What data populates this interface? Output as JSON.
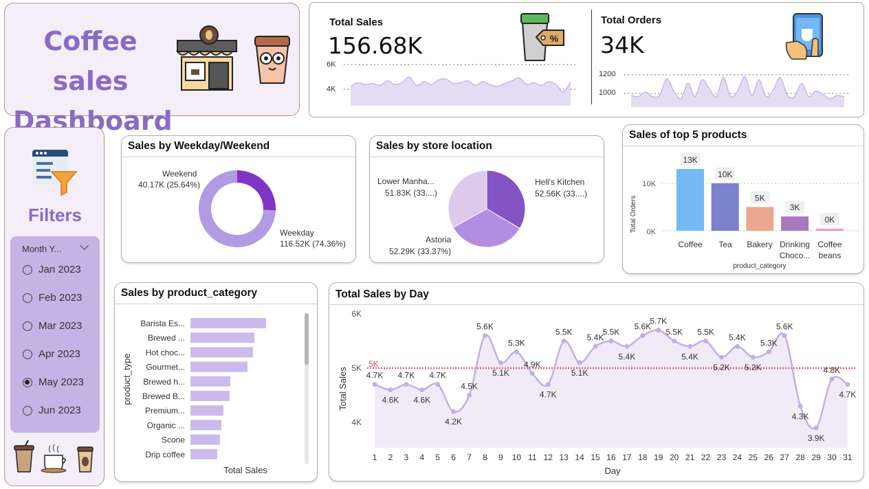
{
  "dashboard": {
    "title_line1": "Coffee sales",
    "title_line2": "Dashboard"
  },
  "kpis": {
    "total_sales": {
      "title": "Total Sales",
      "value": "156.68K",
      "axis_hi": "6K",
      "axis_lo": "4K"
    },
    "total_orders": {
      "title": "Total Orders",
      "value": "34K",
      "axis_hi": "1200",
      "axis_lo": "1000"
    }
  },
  "filters": {
    "title": "Filters",
    "slicer_header": "Month Y...",
    "options": [
      {
        "label": "Jan 2023",
        "selected": false
      },
      {
        "label": "Feb 2023",
        "selected": false
      },
      {
        "label": "Mar 2023",
        "selected": false
      },
      {
        "label": "Apr 2023",
        "selected": false
      },
      {
        "label": "May 2023",
        "selected": true
      },
      {
        "label": "Jun 2023",
        "selected": false
      }
    ]
  },
  "weekday_weekend": {
    "title": "Sales by Weekday/Weekend",
    "weekend_name": "Weekend",
    "weekend_value": "40.17K (25.64%)",
    "weekday_name": "Weekday",
    "weekday_value": "116.52K (74.36%)"
  },
  "store_location": {
    "title": "Sales by store location",
    "lower_name": "Lower Manha...",
    "lower_value": "51.83K (33....)",
    "hells_name": "Hell's Kitchen",
    "hells_value": "52.56K (33....)",
    "astoria_name": "Astoria",
    "astoria_value": "52.29K (33.37%)"
  },
  "top_products": {
    "title": "Sales of top 5 products",
    "ylabel": "Total Orders",
    "xlabel": "product_category",
    "tick_hi": "10K",
    "tick_lo": "0K",
    "cat_coffee": "Coffee",
    "cat_tea": "Tea",
    "cat_bakery": "Bakery",
    "cat_choc_1": "Drinking",
    "cat_choc_2": "Choco...",
    "cat_beans_1": "Coffee",
    "cat_beans_2": "beans",
    "label_coffee": "13K",
    "label_tea": "10K",
    "label_bakery": "5K",
    "label_choc": "3K",
    "label_beans": "0K"
  },
  "product_category": {
    "title": "Sales by product_category",
    "ylabel": "product_type",
    "xlabel": "Total Sales",
    "rows": [
      "Barista Es...",
      "Brewed ...",
      "Hot choc...",
      "Gourmet...",
      "Brewed h...",
      "Brewed B...",
      "Premium...",
      "Organic ...",
      "Scone",
      "Drip coffee"
    ]
  },
  "sales_by_day": {
    "title": "Total Sales by Day",
    "ylabel": "Total Sales",
    "xlabel": "Day",
    "tick_6k": "6K",
    "tick_5k": "5K",
    "tick_4k": "4K",
    "avg_label": "5K",
    "days": [
      "1",
      "2",
      "3",
      "4",
      "5",
      "6",
      "7",
      "8",
      "9",
      "10",
      "11",
      "12",
      "13",
      "14",
      "15",
      "16",
      "17",
      "18",
      "19",
      "20",
      "21",
      "22",
      "23",
      "24",
      "25",
      "26",
      "27",
      "28",
      "29",
      "30",
      "31"
    ],
    "point_labels": [
      "4.7K",
      "4.6K",
      "4.7K",
      "4.6K",
      "4.7K",
      "4.2K",
      "4.5K",
      "5.6K",
      "5.1K",
      "5.3K",
      "4.9K",
      "4.7K",
      "5.5K",
      "5.1K",
      "5.4K",
      "5.5K",
      "5.4K",
      "5.6K",
      "5.7K",
      "5.5K",
      "5.4K",
      "5.5K",
      "5.2K",
      "5.4K",
      "5.2K",
      "5.3K",
      "5.6K",
      "4.3K",
      "3.9K",
      "4.8K",
      "4.7K"
    ]
  },
  "chart_data": [
    {
      "type": "line",
      "title": "Total Sales by Day",
      "xlabel": "Day",
      "ylabel": "Total Sales",
      "x": [
        1,
        2,
        3,
        4,
        5,
        6,
        7,
        8,
        9,
        10,
        11,
        12,
        13,
        14,
        15,
        16,
        17,
        18,
        19,
        20,
        21,
        22,
        23,
        24,
        25,
        26,
        27,
        28,
        29,
        30,
        31
      ],
      "values": [
        4700,
        4600,
        4700,
        4600,
        4700,
        4200,
        4500,
        5600,
        5100,
        5300,
        4900,
        4700,
        5500,
        5100,
        5400,
        5500,
        5400,
        5600,
        5700,
        5500,
        5400,
        5500,
        5200,
        5400,
        5200,
        5300,
        5600,
        4300,
        3900,
        4800,
        4700
      ],
      "average_line": 5000,
      "ylim": [
        3700,
        6000
      ]
    },
    {
      "type": "bar",
      "title": "Sales of top 5 products",
      "xlabel": "product_category",
      "ylabel": "Total Orders",
      "categories": [
        "Coffee",
        "Tea",
        "Bakery",
        "Drinking Choco...",
        "Coffee beans"
      ],
      "values": [
        13000,
        10000,
        5000,
        3000,
        250
      ],
      "colors": [
        "#74b9f4",
        "#7a82cc",
        "#eba88f",
        "#a777c2",
        "#e79cc9"
      ],
      "ylim": [
        0,
        13000
      ]
    },
    {
      "type": "pie",
      "title": "Sales by Weekday/Weekend",
      "categories": [
        "Weekday",
        "Weekend"
      ],
      "values": [
        116.52,
        40.17
      ],
      "colors": [
        "#b39ae4",
        "#7e35c3"
      ]
    },
    {
      "type": "pie",
      "title": "Sales by store location",
      "categories": [
        "Hell's Kitchen",
        "Astoria",
        "Lower Manha..."
      ],
      "values": [
        52.56,
        52.29,
        51.83
      ],
      "colors": [
        "#8454c4",
        "#b38ee0",
        "#dcc9ec"
      ]
    },
    {
      "type": "bar",
      "title": "Sales by product_category",
      "xlabel": "Total Sales",
      "ylabel": "product_type",
      "categories": [
        "Barista Es...",
        "Brewed ...",
        "Hot choc...",
        "Gourmet...",
        "Brewed h...",
        "Brewed B...",
        "Premium...",
        "Organic ...",
        "Scone",
        "Drip coffee"
      ],
      "values": [
        110,
        93,
        91,
        83,
        58,
        57,
        48,
        45,
        43,
        39
      ],
      "color": "#cbbbec"
    },
    {
      "type": "area",
      "title": "Total Sales",
      "values": [
        4600,
        4800,
        4700,
        4750,
        4650,
        4900,
        4700,
        4800,
        5100,
        4650,
        4850,
        4700,
        4950,
        5000,
        4750,
        4800,
        4900,
        4650,
        4850,
        4700,
        4600,
        4750,
        4900,
        5050,
        4700,
        4800,
        4650,
        4850,
        4700,
        4300,
        4850
      ],
      "ylim": [
        3700,
        6000
      ]
    },
    {
      "type": "area",
      "title": "Total Orders",
      "values": [
        1010,
        1000,
        1040,
        1000,
        1010,
        1160,
        1050,
        980,
        1120,
        1000,
        1150,
        1070,
        1000,
        1170,
        1000,
        1050,
        1180,
        1010,
        1150,
        1000,
        1060,
        1170,
        1010,
        1000,
        1120,
        1000,
        1050,
        1020,
        980,
        1010,
        1000
      ],
      "ylim": [
        930,
        1250
      ]
    }
  ]
}
